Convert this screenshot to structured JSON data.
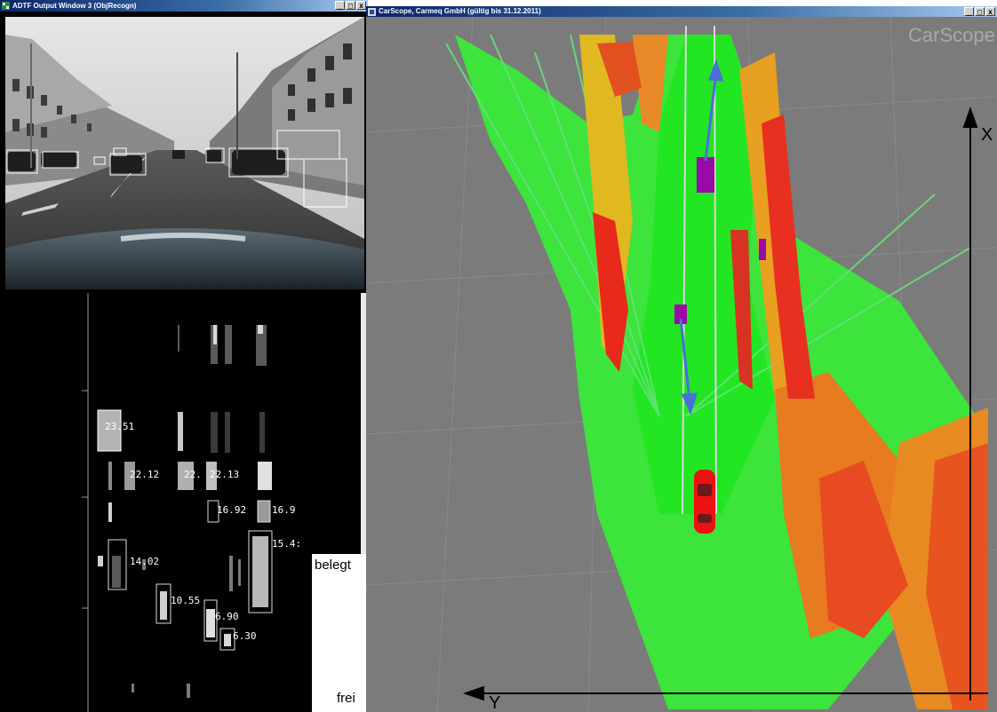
{
  "camera_window": {
    "title": "ADTF Output Window 3 (ObjRecogn)",
    "buttons": {
      "minimize": "_",
      "maximize": "□",
      "close": "x"
    }
  },
  "carscope_window": {
    "title": "CarScope, Carmeq GmbH (gültig bis 31.12.2011)",
    "watermark": "CarScope",
    "buttons": {
      "minimize": "_",
      "maximize": "□",
      "close": "x"
    },
    "axes": {
      "x_label": "X",
      "y_label": "Y"
    }
  },
  "object_labels": [
    "23.51",
    "22.12",
    "22.",
    "22.13",
    "16.92",
    "16.9",
    "14.02",
    "15.4:",
    "10.55",
    "6.90",
    "6.30"
  ],
  "legend": {
    "top": "belegt",
    "bottom": "frei"
  },
  "colors": {
    "free": "#30e030",
    "occupied": "#e02020",
    "grid_bg": "#7b7b7b",
    "ego_car": "#ee1111",
    "object": "#9a0aa8",
    "arrow": "#4a6fd8"
  }
}
